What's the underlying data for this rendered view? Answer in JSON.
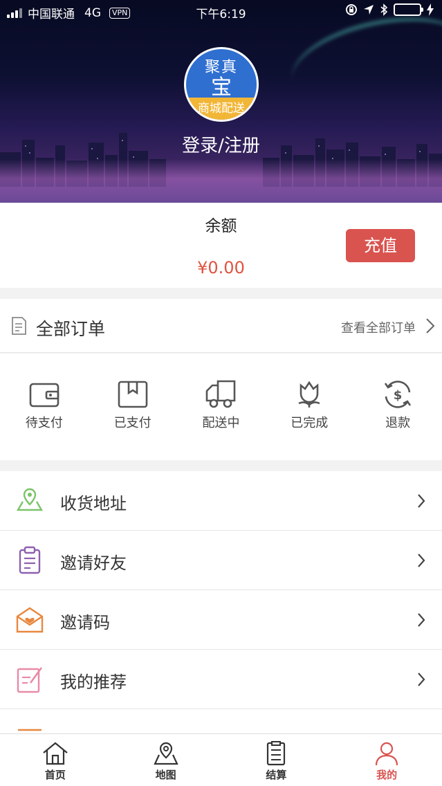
{
  "status_bar": {
    "carrier": "中国联通",
    "network": "4G",
    "vpn": "VPN",
    "time": "下午6:19"
  },
  "header": {
    "logo_line1": "聚真",
    "logo_line2": "宝",
    "logo_line3": "商城配送",
    "login_text": "登录/注册"
  },
  "balance": {
    "label": "余额",
    "amount": "¥0.00",
    "recharge_label": "充值"
  },
  "orders": {
    "title": "全部订单",
    "view_all": "查看全部订单",
    "states": [
      {
        "label": "待支付",
        "icon": "wallet-icon"
      },
      {
        "label": "已支付",
        "icon": "package-icon"
      },
      {
        "label": "配送中",
        "icon": "truck-icon"
      },
      {
        "label": "已完成",
        "icon": "flower-icon"
      },
      {
        "label": "退款",
        "icon": "refund-icon"
      }
    ]
  },
  "menu": [
    {
      "label": "收货地址",
      "icon": "map-pin-icon",
      "color": "#7cc36a"
    },
    {
      "label": "邀请好友",
      "icon": "clipboard-icon",
      "color": "#8e5fb0"
    },
    {
      "label": "邀请码",
      "icon": "envelope-heart-icon",
      "color": "#e8883e"
    },
    {
      "label": "我的推荐",
      "icon": "edit-note-icon",
      "color": "#e88aa6"
    }
  ],
  "tabbar": [
    {
      "label": "首页",
      "icon": "home-icon"
    },
    {
      "label": "地图",
      "icon": "map-icon"
    },
    {
      "label": "结算",
      "icon": "checkout-list-icon"
    },
    {
      "label": "我的",
      "icon": "user-icon",
      "active": true
    }
  ],
  "colors": {
    "accent_red": "#d9534f",
    "amount_red": "#e0533f",
    "logo_blue": "#2f6fd0",
    "logo_gold": "#f2b636"
  }
}
